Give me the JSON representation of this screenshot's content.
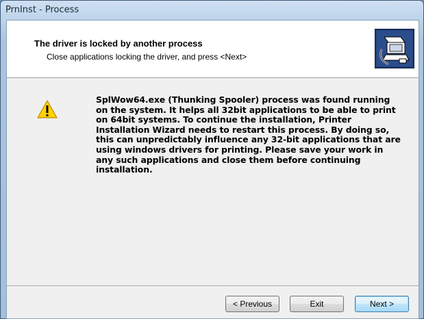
{
  "window": {
    "title": "PrnInst - Process"
  },
  "header": {
    "title": "The driver is locked by another process",
    "subtitle": "Close applications locking the driver, and press <Next>",
    "icon": "installer-computer-icon"
  },
  "body": {
    "icon": "warning-icon",
    "message": "SplWow64.exe (Thunking Spooler) process was found running on the system. It helps all 32bit applications to be able to print on 64bit systems. To continue the installation, Printer Installation Wizard needs to restart this process. By doing so, this can unpredictably influence any 32-bit applications that are using windows drivers for printing. Please save your work in any such applications and close them before continuing installation."
  },
  "buttons": {
    "previous": "< Previous",
    "exit": "Exit",
    "next": "Next >"
  }
}
